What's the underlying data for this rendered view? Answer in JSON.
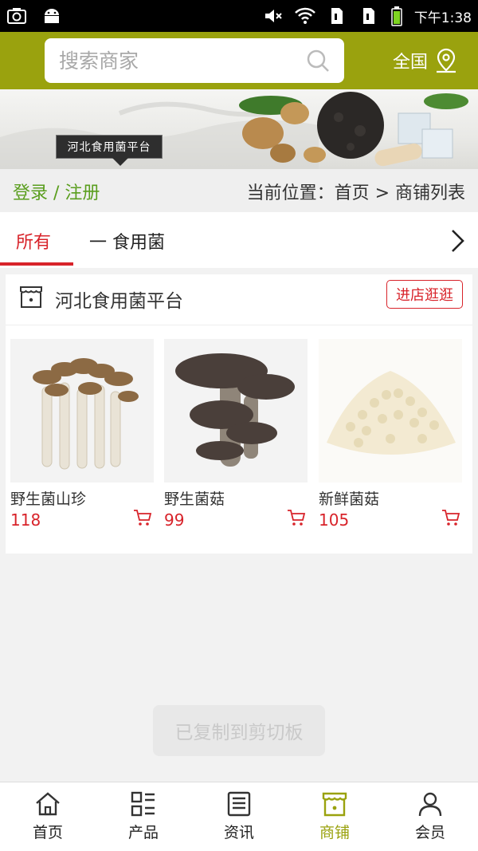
{
  "status_bar": {
    "time": "下午1:38",
    "icons": [
      "screenshot-icon",
      "android-icon",
      "mute-icon",
      "wifi-icon",
      "sim1-icon",
      "sim2-icon",
      "battery-icon"
    ]
  },
  "colors": {
    "brand": "#9aa20e",
    "accent_red": "#d8232a",
    "link_green": "#5a9e1e"
  },
  "search": {
    "placeholder": "搜索商家"
  },
  "region": {
    "label": "全国"
  },
  "banner": {
    "logo_text": "河北食用菌平台"
  },
  "breadcrumb": {
    "login": "登录 / 注册",
    "path": "当前位置：首页 > 商铺列表"
  },
  "tabs": [
    {
      "label": "所有",
      "active": true
    },
    {
      "label": "一 食用菌",
      "active": false
    }
  ],
  "shop": {
    "name": "河北食用菌平台",
    "visit_label": "进店逛逛",
    "products": [
      {
        "name": "野生菌山珍",
        "price": "118"
      },
      {
        "name": "野生菌菇",
        "price": "99"
      },
      {
        "name": "新鲜菌菇",
        "price": "105"
      }
    ]
  },
  "toast": {
    "text": "已复制到剪切板"
  },
  "bottom_nav": [
    {
      "label": "首页",
      "icon": "home-icon",
      "active": false
    },
    {
      "label": "产品",
      "icon": "grid-list-icon",
      "active": false
    },
    {
      "label": "资讯",
      "icon": "news-icon",
      "active": false
    },
    {
      "label": "商铺",
      "icon": "shop-icon",
      "active": true
    },
    {
      "label": "会员",
      "icon": "user-icon",
      "active": false
    }
  ]
}
